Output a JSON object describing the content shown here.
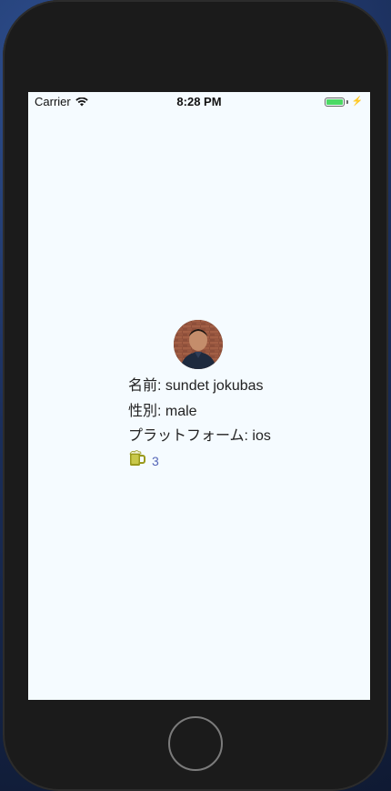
{
  "status_bar": {
    "carrier": "Carrier",
    "time": "8:28 PM",
    "battery_level": 1.0,
    "charging_icon": "bolt-icon",
    "wifi_icon": "wifi-icon"
  },
  "profile": {
    "name_line": "名前: sundet jokubas",
    "gender_line": "性別: male",
    "platform_line": "プラットフォーム: ios",
    "beer_count": "3",
    "beer_icon": "beer-mug-icon"
  },
  "colors": {
    "screen_background": "#f5fbff",
    "count_text": "#5566b8",
    "beer_icon": "#9a9a1c",
    "battery": "#4cd964"
  }
}
